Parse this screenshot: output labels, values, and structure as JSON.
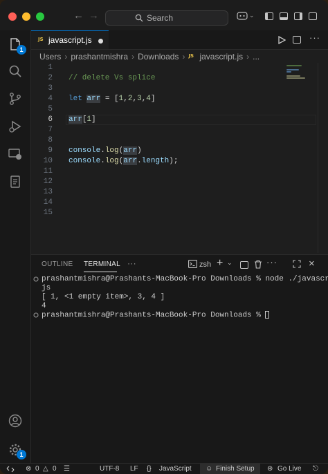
{
  "titlebar": {
    "search_placeholder": "Search"
  },
  "activity_bar": {
    "explorer_badge": "1",
    "manage_badge": "1"
  },
  "tab": {
    "label": "javascript.js",
    "icon_text": "JS",
    "modified": true
  },
  "breadcrumb": {
    "items": [
      "Users",
      "prashantmishra",
      "Downloads",
      "javascript.js",
      "..."
    ]
  },
  "editor": {
    "line_numbers": [
      "1",
      "2",
      "3",
      "4",
      "5",
      "6",
      "7",
      "8",
      "9",
      "10",
      "11",
      "12",
      "13",
      "14",
      "15"
    ],
    "active_line": "6",
    "lines": [
      "",
      "// delete Vs splice",
      "",
      "let arr = [1,2,3,4]",
      "",
      "arr[1]",
      "",
      "",
      "console.log(arr)",
      "console.log(arr.length);",
      "",
      "",
      "",
      "",
      ""
    ]
  },
  "panel": {
    "tabs": [
      "OUTLINE",
      "TERMINAL",
      "···"
    ],
    "active_tab": "TERMINAL",
    "shell_label": "zsh",
    "terminal_lines": [
      "prashantmishra@Prashants-MacBook-Pro Downloads % node ./javascript.",
      "js",
      "[ 1, <1 empty item>, 3, 4 ]",
      "4",
      "prashantmishra@Prashants-MacBook-Pro Downloads % "
    ]
  },
  "statusbar": {
    "errors": "0",
    "warnings": "0",
    "encoding": "UTF-8",
    "eol": "LF",
    "language": "JavaScript",
    "finish_setup": "Finish Setup",
    "go_live": "Go Live"
  },
  "colors": {
    "accent": "#0078d4",
    "keyword": "#569cd6",
    "variable": "#9cdcfe",
    "comment": "#6a9955",
    "function": "#dcdcaa",
    "number": "#b5cea8",
    "js_yellow": "#e8c24a"
  }
}
